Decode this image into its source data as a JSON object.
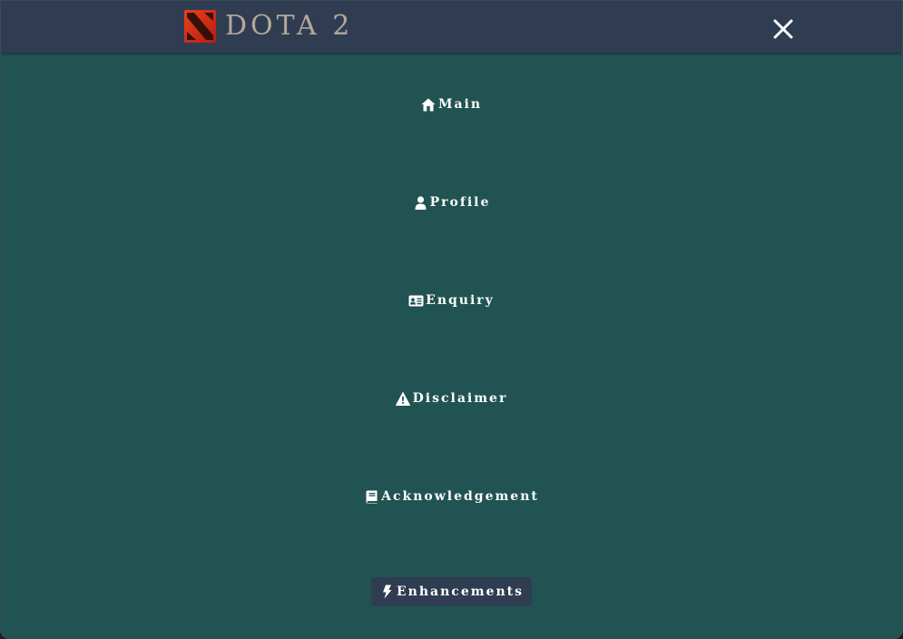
{
  "header": {
    "brand_text": "DOTA 2",
    "logo_icon": "dota2-logo-icon",
    "close_icon": "close-icon",
    "background": "#2f3c52"
  },
  "menu": {
    "background": "#215352",
    "active_background": "#2f3c52",
    "items": [
      {
        "label": "Main",
        "icon": "home-icon",
        "active": false
      },
      {
        "label": "Profile",
        "icon": "user-icon",
        "active": false
      },
      {
        "label": "Enquiry",
        "icon": "id-card-icon",
        "active": false
      },
      {
        "label": "Disclaimer",
        "icon": "warning-icon",
        "active": false
      },
      {
        "label": "Acknowledgement",
        "icon": "book-icon",
        "active": false
      },
      {
        "label": "Enhancements",
        "icon": "bolt-icon",
        "active": true
      }
    ]
  }
}
